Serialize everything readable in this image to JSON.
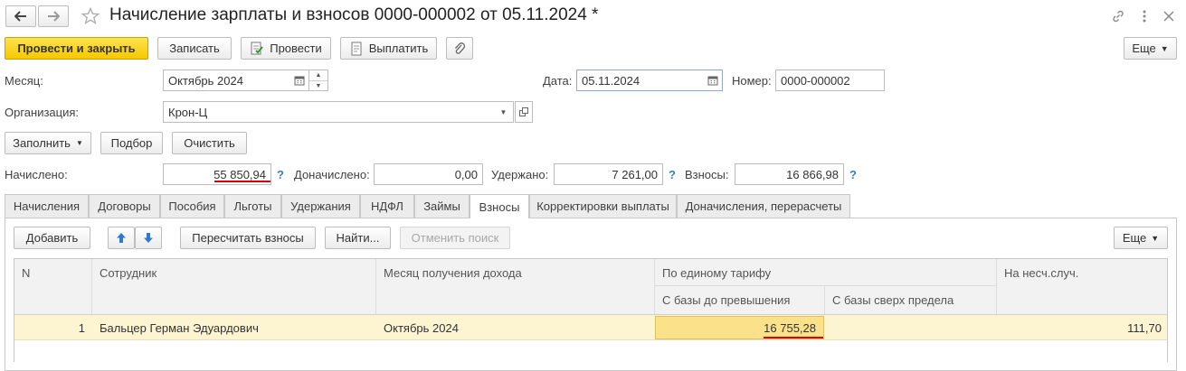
{
  "window": {
    "title": "Начисление зарплаты и взносов 0000-000002 от 05.11.2024 *"
  },
  "toolbar": {
    "post_close": "Провести и закрыть",
    "save": "Записать",
    "post": "Провести",
    "pay": "Выплатить",
    "more": "Еще"
  },
  "form": {
    "month_label": "Месяц:",
    "month_value": "Октябрь 2024",
    "date_label": "Дата:",
    "date_value": "05.11.2024",
    "number_label": "Номер:",
    "number_value": "0000-000002",
    "org_label": "Организация:",
    "org_value": "Крон-Ц"
  },
  "actions": {
    "fill": "Заполнить",
    "select": "Подбор",
    "clear": "Очистить"
  },
  "totals": {
    "accrued_label": "Начислено:",
    "accrued_value": "55 850,94",
    "extra_label": "Доначислено:",
    "extra_value": "0,00",
    "withheld_label": "Удержано:",
    "withheld_value": "7 261,00",
    "contrib_label": "Взносы:",
    "contrib_value": "16 866,98",
    "help": "?"
  },
  "tabs": [
    "Начисления",
    "Договоры",
    "Пособия",
    "Льготы",
    "Удержания",
    "НДФЛ",
    "Займы",
    "Взносы",
    "Корректировки выплаты",
    "Доначисления, перерасчеты"
  ],
  "active_tab": "Взносы",
  "table_toolbar": {
    "add": "Добавить",
    "recalc": "Пересчитать взносы",
    "find": "Найти...",
    "cancel_search": "Отменить поиск",
    "more": "Еще"
  },
  "table": {
    "headers": {
      "n": "N",
      "employee": "Сотрудник",
      "income_month": "Месяц получения дохода",
      "single_rate": "По единому тарифу",
      "base_under": "С базы до превышения",
      "base_over": "С базы сверх предела",
      "accident": "На несч.случ."
    },
    "rows": [
      {
        "n": "1",
        "employee": "Бальцер Герман Эдуардович",
        "income_month": "Октябрь 2024",
        "base_under": "16 755,28",
        "base_over": "",
        "accident": "111,70"
      }
    ]
  },
  "colors": {
    "primary_button": "#f5c800",
    "selected_row": "#fdf5d2",
    "selected_cell": "#fbe18a",
    "underline_red": "#d8000c",
    "help_blue": "#3d7bbd"
  }
}
